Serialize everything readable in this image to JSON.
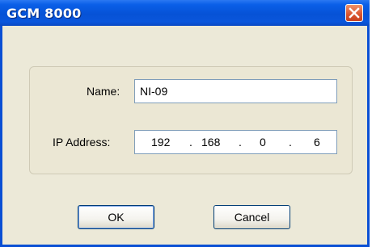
{
  "window": {
    "title": "GCM 8000"
  },
  "form": {
    "name_label": "Name:",
    "name_value": "NI-09",
    "ip_label": "IP Address:",
    "ip_octets": [
      "192",
      "168",
      "0",
      "6"
    ],
    "ip_separator": "."
  },
  "buttons": {
    "ok_label": "OK",
    "cancel_label": "Cancel"
  },
  "icons": {
    "close": "close-icon"
  },
  "colors": {
    "titlebar": "#0652d6",
    "client": "#ece9d8",
    "close": "#d9532e"
  }
}
